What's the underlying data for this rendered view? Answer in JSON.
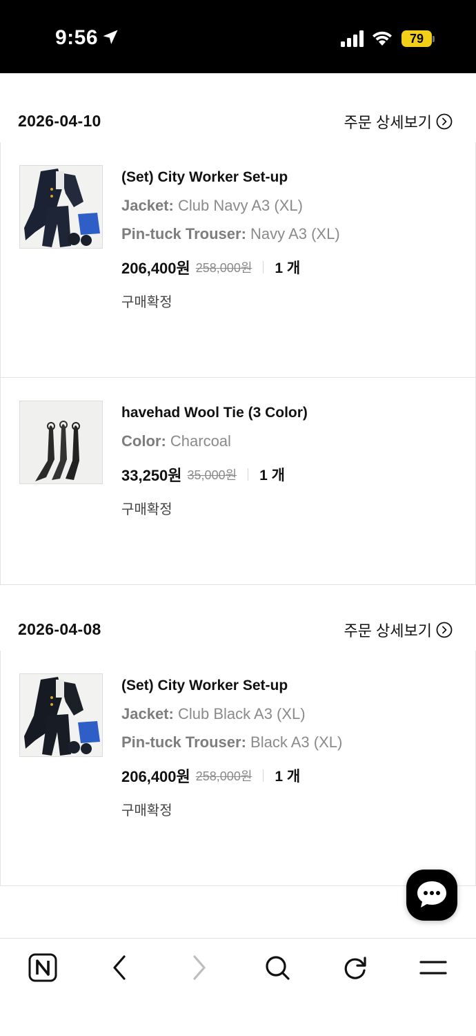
{
  "status_bar": {
    "time": "9:56",
    "battery": "79",
    "icons": [
      "location-arrow-icon",
      "cellular-signal-icon",
      "wifi-icon",
      "battery-icon"
    ],
    "battery_color": "#f4cf18"
  },
  "orders": [
    {
      "date": "2026-04-10",
      "detail_label": "주문 상세보기",
      "items": [
        {
          "title": "(Set) City Worker Set-up",
          "options": [
            {
              "key": "Jacket:",
              "value": "Club Navy A3 (XL)"
            },
            {
              "key": "Pin-tuck Trouser:",
              "value": "Navy A3 (XL)"
            }
          ],
          "price": "206,400원",
          "original_price": "258,000원",
          "quantity": "1 개",
          "status": "구매확정"
        },
        {
          "title": "havehad Wool Tie (3 Color)",
          "options": [
            {
              "key": "Color:",
              "value": "Charcoal"
            }
          ],
          "price": "33,250원",
          "original_price": "35,000원",
          "quantity": "1 개",
          "status": "구매확정"
        }
      ]
    },
    {
      "date": "2026-04-08",
      "detail_label": "주문 상세보기",
      "items": [
        {
          "title": "(Set) City Worker Set-up",
          "options": [
            {
              "key": "Jacket:",
              "value": "Club Black A3 (XL)"
            },
            {
              "key": "Pin-tuck Trouser:",
              "value": "Black A3 (XL)"
            }
          ],
          "price": "206,400원",
          "original_price": "258,000원",
          "quantity": "1 개",
          "status": "구매확정"
        }
      ]
    }
  ],
  "chat_fab": {
    "icon": "chat-bubble-icon"
  },
  "bottom_nav": {
    "icons": [
      "naver-home-icon",
      "back-arrow-icon",
      "forward-arrow-icon",
      "search-icon",
      "reload-icon",
      "menu-icon"
    ]
  }
}
